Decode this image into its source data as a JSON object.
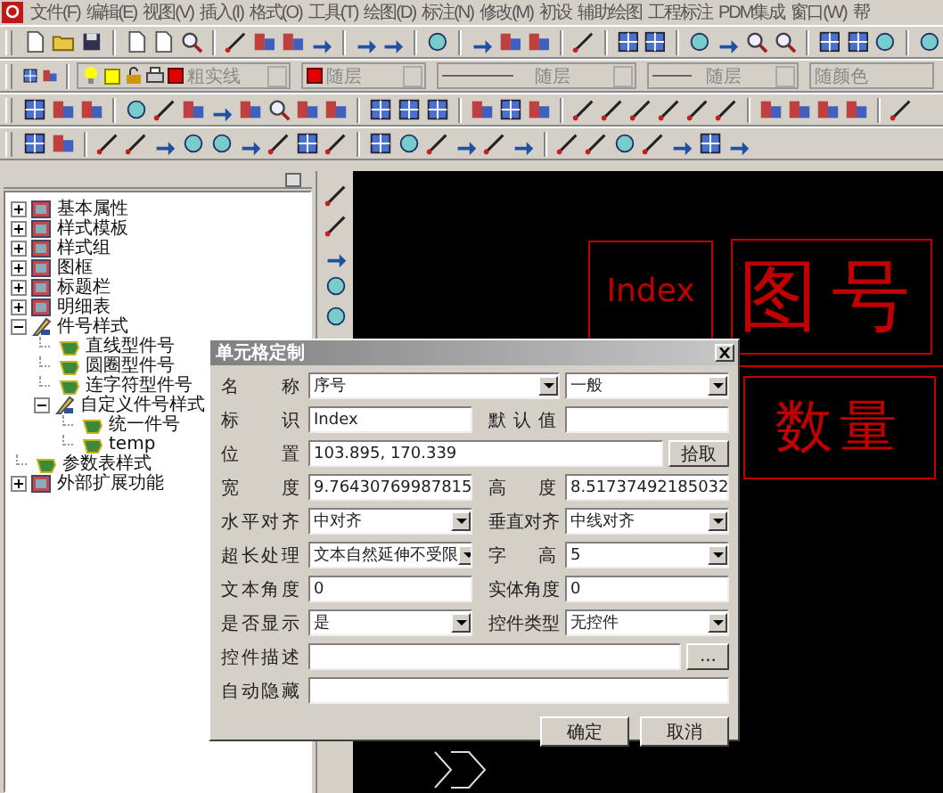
{
  "menu_bar": {
    "items": [
      "文件(F)",
      "编辑(E)",
      "视图(V)",
      "插入(I)",
      "格式(O)",
      "工具(T)",
      "绘图(D)",
      "标注(N)",
      "修改(M)",
      "初设",
      "辅助绘图",
      "工程标注",
      "PDM集成",
      "窗口(W)",
      "帮"
    ]
  },
  "properties_toolbar": {
    "layer": "粗实线",
    "color_by": "随层",
    "line_type": "随层",
    "line_width": "随层",
    "line_color": "随颜色"
  },
  "tree": {
    "items": [
      {
        "label": "基本属性",
        "kind": "folder",
        "expanded": false
      },
      {
        "label": "样式模板",
        "kind": "folder",
        "expanded": false
      },
      {
        "label": "样式组",
        "kind": "folder",
        "expanded": false
      },
      {
        "label": "图框",
        "kind": "folder",
        "expanded": false
      },
      {
        "label": "标题栏",
        "kind": "folder",
        "expanded": false
      },
      {
        "label": "明细表",
        "kind": "folder",
        "expanded": false
      },
      {
        "label": "件号样式",
        "kind": "folder",
        "expanded": true,
        "children": [
          {
            "label": "直线型件号",
            "kind": "leaf"
          },
          {
            "label": "圆圈型件号",
            "kind": "leaf"
          },
          {
            "label": "连字符型件号",
            "kind": "leaf"
          },
          {
            "label": "自定义件号样式",
            "kind": "folder",
            "expanded": true,
            "children": [
              {
                "label": "统一件号",
                "kind": "leaf"
              },
              {
                "label": "temp",
                "kind": "leaf"
              }
            ]
          }
        ]
      },
      {
        "label": "参数表样式",
        "kind": "leaf"
      },
      {
        "label": "外部扩展功能",
        "kind": "folder",
        "expanded": false
      }
    ]
  },
  "canvas": {
    "cells": [
      {
        "text": "Index"
      },
      {
        "text": "图号"
      },
      {
        "text": "数量"
      }
    ]
  },
  "dialog": {
    "title": "单元格定制",
    "rows": [
      [
        {
          "kind": "label",
          "text": "名 称"
        },
        {
          "kind": "combo",
          "value": "序号"
        },
        "",
        {
          "kind": "combo",
          "value": "一般"
        }
      ],
      [
        {
          "kind": "label",
          "text": "标 识"
        },
        {
          "kind": "text",
          "value": "Index"
        },
        {
          "kind": "label",
          "text": "默认值"
        },
        {
          "kind": "text"
        }
      ],
      [
        {
          "kind": "label",
          "text": "位 置"
        },
        {
          "kind": "text",
          "value": "103.895, 170.339"
        },
        {
          "kind": "button",
          "text": "拾取"
        }
      ],
      [
        {
          "kind": "label",
          "text": "宽 度"
        },
        {
          "kind": "text",
          "value": "9.76430769987815"
        },
        {
          "kind": "label",
          "text": "高 度"
        },
        {
          "kind": "text",
          "value": "8.51737492185032"
        }
      ],
      [
        {
          "kind": "label",
          "text": "水平对齐"
        },
        {
          "kind": "combo",
          "value": "中对齐"
        },
        {
          "kind": "label",
          "text": "垂直对齐"
        },
        {
          "kind": "combo",
          "value": "中线对齐"
        }
      ],
      [
        {
          "kind": "label",
          "text": "超长处理"
        },
        {
          "kind": "combo",
          "value": "文本自然延伸不受限"
        },
        {
          "kind": "label",
          "text": "字 高"
        },
        {
          "kind": "combo",
          "value": "5"
        }
      ],
      [
        {
          "kind": "label",
          "text": "文本角度"
        },
        {
          "kind": "text",
          "value": "0"
        },
        {
          "kind": "label",
          "text": "实体角度"
        },
        {
          "kind": "text",
          "value": "0"
        }
      ],
      [
        {
          "kind": "label",
          "text": "是否显示"
        },
        {
          "kind": "combo",
          "value": "是"
        },
        {
          "kind": "label",
          "text": "控件类型"
        },
        {
          "kind": "combo",
          "value": "无控件"
        }
      ],
      [
        {
          "kind": "label",
          "text": "控件描述"
        },
        {
          "kind": "text"
        },
        {
          "kind": "button",
          "text": "..."
        }
      ],
      [
        {
          "kind": "label",
          "text": "自动隐藏"
        },
        {
          "kind": "text"
        }
      ]
    ],
    "buttons": [
      "确定",
      "取消"
    ]
  }
}
